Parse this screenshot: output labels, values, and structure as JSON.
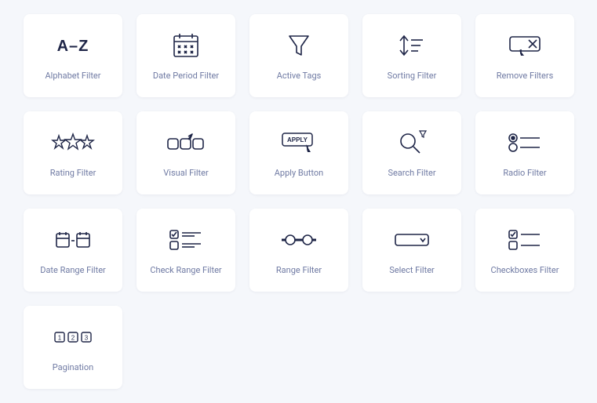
{
  "items": [
    {
      "key": "alphabet",
      "label": "Alphabet Filter"
    },
    {
      "key": "dateperiod",
      "label": "Date Period Filter"
    },
    {
      "key": "activetags",
      "label": "Active Tags"
    },
    {
      "key": "sorting",
      "label": "Sorting Filter"
    },
    {
      "key": "remove",
      "label": "Remove Filters"
    },
    {
      "key": "rating",
      "label": "Rating Filter"
    },
    {
      "key": "visual",
      "label": "Visual Filter"
    },
    {
      "key": "apply",
      "label": "Apply Button"
    },
    {
      "key": "search",
      "label": "Search Filter"
    },
    {
      "key": "radio",
      "label": "Radio Filter"
    },
    {
      "key": "daterange",
      "label": "Date Range Filter"
    },
    {
      "key": "checkrange",
      "label": "Check Range Filter"
    },
    {
      "key": "range",
      "label": "Range Filter"
    },
    {
      "key": "select",
      "label": "Select Filter"
    },
    {
      "key": "checkboxes",
      "label": "Checkboxes Filter"
    },
    {
      "key": "pagination",
      "label": "Pagination"
    }
  ],
  "apply_text": "APPLY"
}
